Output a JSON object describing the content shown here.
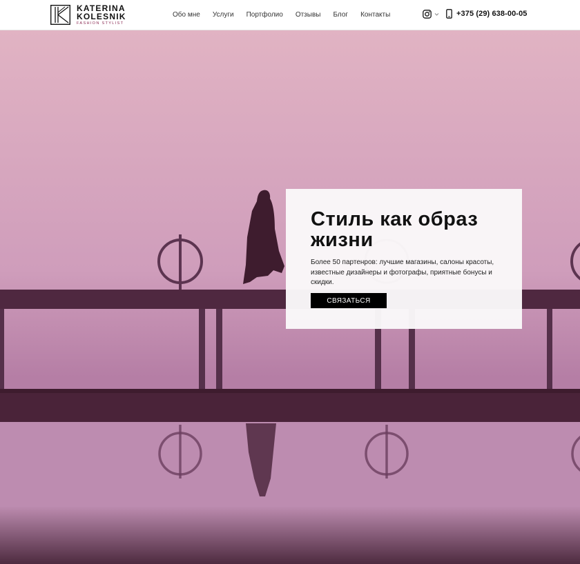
{
  "header": {
    "logo": {
      "line1": "KATERINA",
      "line2": "KOLESNIK",
      "tagline": "FASHION STYLIST"
    },
    "nav": [
      {
        "label": "Обо мне"
      },
      {
        "label": "Услуги"
      },
      {
        "label": "Портфолио"
      },
      {
        "label": "Отзывы"
      },
      {
        "label": "Блог"
      },
      {
        "label": "Контакты"
      }
    ],
    "social_icon": "instagram-icon",
    "phone": "+375 (29) 638-00-05"
  },
  "hero": {
    "title": "Стиль как образ жизни",
    "text": "Более 50 партенров: лучшие магазины, салоны красоты, известные дизайнеры и фотографы, приятные бонусы и скидки.",
    "button": "СВЯЗАТЬСЯ"
  },
  "colors": {
    "accent": "#8b2a52",
    "hero_sky": "#d8a9bf",
    "hero_dark": "#3e1c2e",
    "button_bg": "#000000"
  }
}
